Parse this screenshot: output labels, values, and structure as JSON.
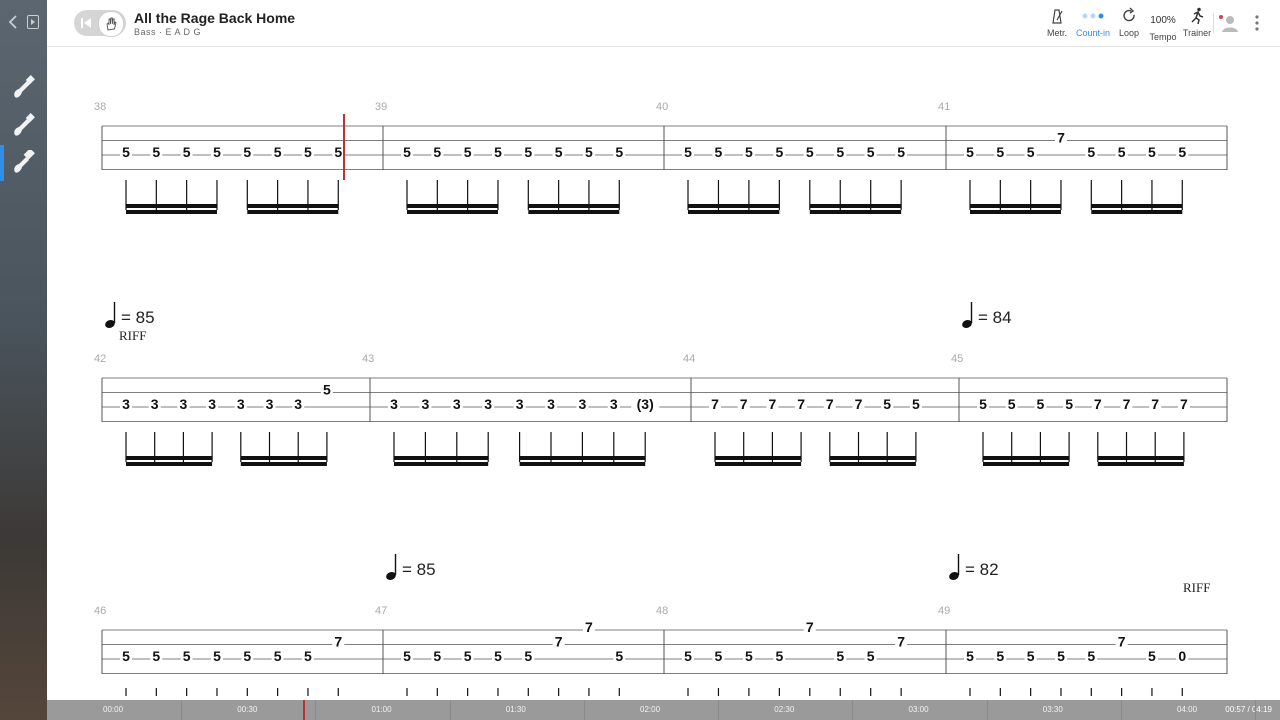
{
  "app": {
    "title": "All the Rage Back Home",
    "subtitle": "Bass · E A D G"
  },
  "toolbar": [
    {
      "id": "metronome",
      "label": "Metr.",
      "icon": "metronome-icon",
      "active": false
    },
    {
      "id": "count-in",
      "label": "Count-in",
      "icon": "count-in-dots-icon",
      "active": true
    },
    {
      "id": "loop",
      "label": "Loop",
      "icon": "loop-icon",
      "active": false
    },
    {
      "id": "tempo",
      "label": "Tempo",
      "value": "100%",
      "active": false
    },
    {
      "id": "trainer",
      "label": "Trainer",
      "icon": "runner-icon",
      "active": false
    }
  ],
  "colors": {
    "accent": "#2e8ee8",
    "playhead": "#c0303a",
    "staff": "#333333",
    "measure_number": "#aaaaaa"
  },
  "sidebar": {
    "icons": [
      "chevron-left-icon",
      "panel-toggle-icon"
    ],
    "instruments": [
      {
        "name": "guitar-1-icon",
        "active": false
      },
      {
        "name": "guitar-2-icon",
        "active": false
      },
      {
        "name": "bass-icon",
        "active": true
      }
    ]
  },
  "score": {
    "systems": [
      {
        "tempos": [],
        "markers": [],
        "measures": [
          {
            "number": "38",
            "notes": [
              [
                "5",
                0
              ],
              [
                "5",
                0
              ],
              [
                "5",
                0
              ],
              [
                "5",
                0
              ],
              [
                "5",
                0
              ],
              [
                "5",
                0
              ],
              [
                "5",
                0
              ],
              [
                "5",
                0
              ]
            ],
            "beams": [
              [
                0,
                3
              ],
              [
                4,
                7
              ]
            ]
          },
          {
            "number": "39",
            "notes": [
              [
                "5",
                0
              ],
              [
                "5",
                0
              ],
              [
                "5",
                0
              ],
              [
                "5",
                0
              ],
              [
                "5",
                0
              ],
              [
                "5",
                0
              ],
              [
                "5",
                0
              ],
              [
                "5",
                0
              ]
            ],
            "beams": [
              [
                0,
                3
              ],
              [
                4,
                7
              ]
            ]
          },
          {
            "number": "40",
            "notes": [
              [
                "5",
                0
              ],
              [
                "5",
                0
              ],
              [
                "5",
                0
              ],
              [
                "5",
                0
              ],
              [
                "5",
                0
              ],
              [
                "5",
                0
              ],
              [
                "5",
                0
              ],
              [
                "5",
                0
              ]
            ],
            "beams": [
              [
                0,
                3
              ],
              [
                4,
                7
              ]
            ]
          },
          {
            "number": "41",
            "notes": [
              [
                "5",
                0
              ],
              [
                "5",
                0
              ],
              [
                "5",
                0
              ],
              [
                "7",
                1
              ],
              [
                "5",
                0
              ],
              [
                "5",
                0
              ],
              [
                "5",
                0
              ],
              [
                "5",
                0
              ]
            ],
            "beams": [
              [
                0,
                3
              ],
              [
                4,
                7
              ]
            ]
          }
        ]
      },
      {
        "tempos": [
          {
            "value": "= 85",
            "measure": 0
          },
          {
            "value": "= 84",
            "measure": 3
          }
        ],
        "markers": [
          {
            "text": "RIFF",
            "measure": 0
          }
        ],
        "measures": [
          {
            "number": "42",
            "notes": [
              [
                "3",
                0
              ],
              [
                "3",
                0
              ],
              [
                "3",
                0
              ],
              [
                "3",
                0
              ],
              [
                "3",
                0
              ],
              [
                "3",
                0
              ],
              [
                "3",
                0
              ],
              [
                "5",
                1
              ]
            ],
            "beams": [
              [
                0,
                3
              ],
              [
                4,
                7
              ]
            ]
          },
          {
            "number": "43",
            "notes": [
              [
                "3",
                0
              ],
              [
                "3",
                0
              ],
              [
                "3",
                0
              ],
              [
                "3",
                0
              ],
              [
                "3",
                0
              ],
              [
                "3",
                0
              ],
              [
                "3",
                0
              ],
              [
                "3",
                0
              ],
              [
                "(3)",
                0
              ]
            ],
            "beams": [
              [
                0,
                3
              ],
              [
                4,
                8
              ]
            ]
          },
          {
            "number": "44",
            "notes": [
              [
                "7",
                0
              ],
              [
                "7",
                0
              ],
              [
                "7",
                0
              ],
              [
                "7",
                0
              ],
              [
                "7",
                0
              ],
              [
                "7",
                0
              ],
              [
                "5",
                0
              ],
              [
                "5",
                0
              ]
            ],
            "beams": [
              [
                0,
                3
              ],
              [
                4,
                7
              ]
            ]
          },
          {
            "number": "45",
            "notes": [
              [
                "5",
                0
              ],
              [
                "5",
                0
              ],
              [
                "5",
                0
              ],
              [
                "5",
                0
              ],
              [
                "7",
                0
              ],
              [
                "7",
                0
              ],
              [
                "7",
                0
              ],
              [
                "7",
                0
              ]
            ],
            "beams": [
              [
                0,
                3
              ],
              [
                4,
                7
              ]
            ]
          }
        ]
      },
      {
        "tempos": [
          {
            "value": "= 85",
            "measure": 1
          },
          {
            "value": "= 82",
            "measure": 3
          }
        ],
        "markers": [
          {
            "text": "RIFF",
            "measure": 3
          }
        ],
        "measures": [
          {
            "number": "46",
            "notes": [
              [
                "5",
                0
              ],
              [
                "5",
                0
              ],
              [
                "5",
                0
              ],
              [
                "5",
                0
              ],
              [
                "5",
                0
              ],
              [
                "5",
                0
              ],
              [
                "5",
                0
              ],
              [
                "7",
                1
              ]
            ],
            "beams": []
          },
          {
            "number": "47",
            "notes": [
              [
                "5",
                0
              ],
              [
                "5",
                0
              ],
              [
                "5",
                0
              ],
              [
                "5",
                0
              ],
              [
                "5",
                0
              ],
              [
                "7",
                1
              ],
              [
                "7",
                2
              ],
              [
                "5",
                0
              ]
            ],
            "beams": []
          },
          {
            "number": "48",
            "notes": [
              [
                "5",
                0
              ],
              [
                "5",
                0
              ],
              [
                "5",
                0
              ],
              [
                "5",
                0
              ],
              [
                "7",
                2
              ],
              [
                "5",
                0
              ],
              [
                "5",
                0
              ],
              [
                "7",
                1
              ]
            ],
            "beams": []
          },
          {
            "number": "49",
            "notes": [
              [
                "5",
                0
              ],
              [
                "5",
                0
              ],
              [
                "5",
                0
              ],
              [
                "5",
                0
              ],
              [
                "5",
                0
              ],
              [
                "7",
                1
              ],
              [
                "5",
                0
              ],
              [
                "0",
                0
              ]
            ],
            "beams": []
          }
        ]
      }
    ]
  },
  "timeline": {
    "labels": [
      "00:00",
      "00:30",
      "01:00",
      "01:30",
      "02:00",
      "02:30",
      "03:00",
      "03:30",
      "04:00"
    ],
    "current": "00:57 / 04:19",
    "progress": 0.22
  }
}
